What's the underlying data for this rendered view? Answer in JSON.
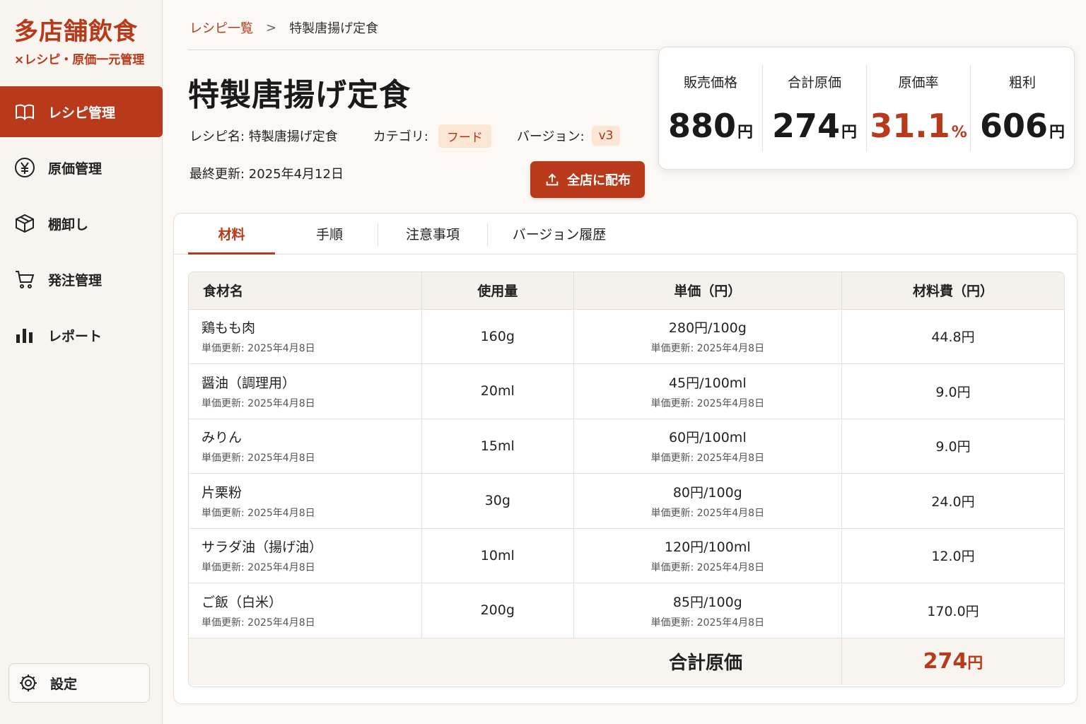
{
  "brand": {
    "title": "多店舗飲食",
    "subtitle": "×レシピ・原価一元管理"
  },
  "nav": [
    {
      "label": "レシピ管理",
      "icon": "book-icon",
      "active": true
    },
    {
      "label": "原価管理",
      "icon": "yen-icon"
    },
    {
      "label": "棚卸し",
      "icon": "box-icon"
    },
    {
      "label": "発注管理",
      "icon": "cart-icon"
    },
    {
      "label": "レポート",
      "icon": "bar-chart-icon"
    }
  ],
  "settings_label": "設定",
  "breadcrumb": {
    "parent": "レシピ一覧",
    "separator": ">",
    "current": "特製唐揚げ定食"
  },
  "recipe": {
    "title": "特製唐揚げ定食",
    "name_label": "レシピ名: 特製唐揚げ定食",
    "category_label": "カテゴリ:",
    "category": "フード",
    "version_label": "バージョン:",
    "version": "v3",
    "updated": "最終更新: 2025年4月12日"
  },
  "distribute_button": "全店に配布",
  "summary": [
    {
      "label": "販売価格",
      "value": "880",
      "unit": "円"
    },
    {
      "label": "合計原価",
      "value": "274",
      "unit": "円"
    },
    {
      "label": "原価率",
      "value": "31.1",
      "unit": "%",
      "accent": true
    },
    {
      "label": "粗利",
      "value": "606",
      "unit": "円"
    }
  ],
  "tabs": [
    "材料",
    "手順",
    "注意事項",
    "バージョン履歴"
  ],
  "table": {
    "headers": [
      "食材名",
      "使用量",
      "単価（円）",
      "材料費（円）"
    ],
    "rows": [
      {
        "name": "鶏もも肉",
        "name_sub": "単価更新: 2025年4月8日",
        "qty": "160g",
        "price": "280円/100g",
        "price_sub": "単価更新: 2025年4月8日",
        "cost": "44.8円"
      },
      {
        "name": "醤油（調理用）",
        "name_sub": "単価更新: 2025年4月8日",
        "qty": "20ml",
        "price": "45円/100ml",
        "price_sub": "単価更新: 2025年4月8日",
        "cost": "9.0円"
      },
      {
        "name": "みりん",
        "name_sub": "単価更新: 2025年4月8日",
        "qty": "15ml",
        "price": "60円/100ml",
        "price_sub": "単価更新: 2025年4月8日",
        "cost": "9.0円"
      },
      {
        "name": "片栗粉",
        "name_sub": "単価更新: 2025年4月8日",
        "qty": "30g",
        "price": "80円/100g",
        "price_sub": "単価更新: 2025年4月8日",
        "cost": "24.0円"
      },
      {
        "name": "サラダ油（揚げ油）",
        "name_sub": "単価更新: 2025年4月8日",
        "qty": "10ml",
        "price": "120円/100ml",
        "price_sub": "単価更新: 2025年4月8日",
        "cost": "12.0円"
      },
      {
        "name": "ご飯（白米）",
        "name_sub": "単価更新: 2025年4月8日",
        "qty": "200g",
        "price": "85円/100g",
        "price_sub": "単価更新: 2025年4月8日",
        "cost": "170.0円"
      }
    ],
    "total_label": "合計原価",
    "total_value": "274",
    "total_unit": "円"
  },
  "colors": {
    "accent": "#b83a1a",
    "chip_bg": "#fbe6d3"
  }
}
